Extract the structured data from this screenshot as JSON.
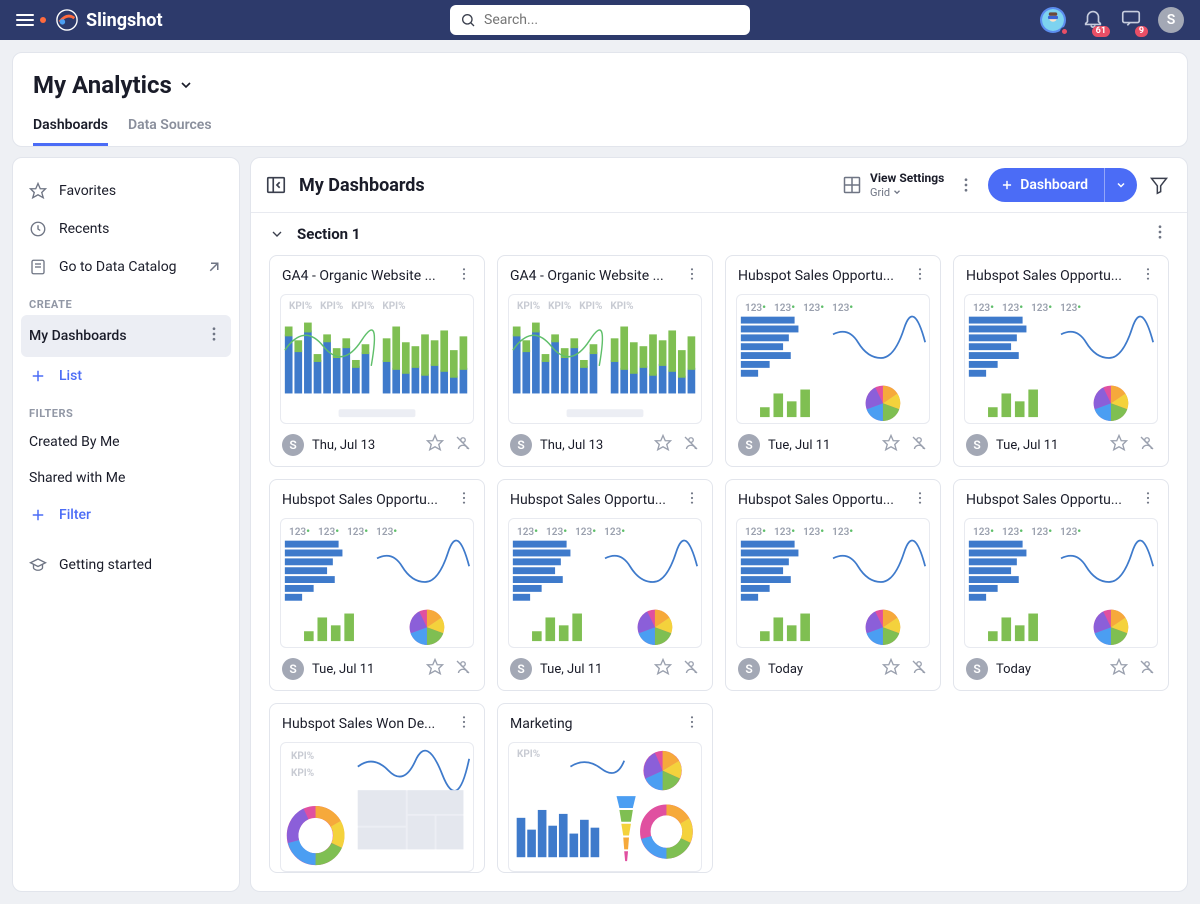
{
  "topbar": {
    "brand": "Slingshot",
    "search_placeholder": "Search...",
    "badge_bell": "61",
    "badge_chat": "9",
    "avatar_initial": "S"
  },
  "page_title": "My Analytics",
  "tabs": {
    "dashboards": "Dashboards",
    "data_sources": "Data Sources"
  },
  "sidebar": {
    "favorites": "Favorites",
    "recents": "Recents",
    "catalog": "Go to Data Catalog",
    "heading_create": "CREATE",
    "my_dashboards": "My Dashboards",
    "list": "List",
    "heading_filters": "FILTERS",
    "created_by_me": "Created By Me",
    "shared_with_me": "Shared with Me",
    "filter": "Filter",
    "getting_started": "Getting started"
  },
  "content": {
    "title": "My Dashboards",
    "view_settings_label": "View Settings",
    "view_settings_value": "Grid",
    "new_button": "Dashboard",
    "section_title": "Section 1",
    "kpi_label": "KPI%",
    "num_label": "123",
    "avatar_initial": "S"
  },
  "cards": [
    {
      "title": "GA4 - Organic Website ...",
      "date": "Thu, Jul 13",
      "type": "ga4"
    },
    {
      "title": "GA4 - Organic Website ...",
      "date": "Thu, Jul 13",
      "type": "ga4"
    },
    {
      "title": "Hubspot Sales Opportu...",
      "date": "Tue, Jul 11",
      "type": "hub"
    },
    {
      "title": "Hubspot Sales Opportu...",
      "date": "Tue, Jul 11",
      "type": "hub"
    },
    {
      "title": "Hubspot Sales Opportu...",
      "date": "Tue, Jul 11",
      "type": "hub"
    },
    {
      "title": "Hubspot Sales Opportu...",
      "date": "Tue, Jul 11",
      "type": "hub"
    },
    {
      "title": "Hubspot Sales Opportu...",
      "date": "Today",
      "type": "hub"
    },
    {
      "title": "Hubspot Sales Opportu...",
      "date": "Today",
      "type": "hub"
    },
    {
      "title": "Hubspot Sales Won De...",
      "date": "",
      "type": "won"
    },
    {
      "title": "Marketing",
      "date": "",
      "type": "mkt"
    }
  ]
}
